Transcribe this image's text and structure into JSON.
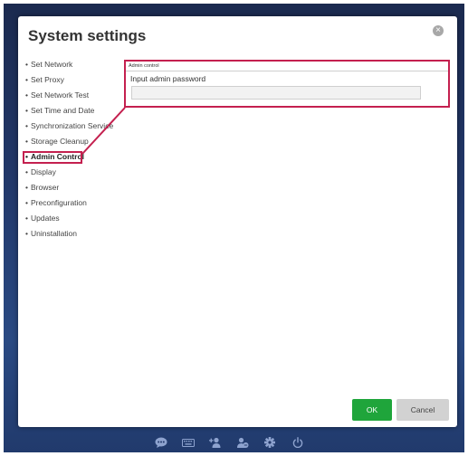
{
  "dialog": {
    "title": "System settings",
    "close_symbol": "×"
  },
  "nav": {
    "items": [
      {
        "label": "Set Network"
      },
      {
        "label": "Set Proxy"
      },
      {
        "label": "Set Network Test"
      },
      {
        "label": "Set Time and Date"
      },
      {
        "label": "Synchronization Service"
      },
      {
        "label": "Storage Cleanup"
      },
      {
        "label": "Admin Control",
        "active": true
      },
      {
        "label": "Display"
      },
      {
        "label": "Browser"
      },
      {
        "label": "Preconfiguration"
      },
      {
        "label": "Updates"
      },
      {
        "label": "Uninstallation"
      }
    ]
  },
  "panel": {
    "header": "Admin control",
    "label": "Input admin password",
    "password_value": "",
    "password_placeholder": ""
  },
  "buttons": {
    "ok_label": "OK",
    "cancel_label": "Cancel"
  },
  "taskbar": {
    "icons": [
      "chat-icon",
      "keyboard-icon",
      "add-user-icon",
      "switch-user-icon",
      "gear-icon",
      "power-icon"
    ]
  },
  "colors": {
    "highlight": "#c4204f",
    "ok_button": "#1fa53b",
    "cancel_button": "#d2d2d2",
    "background": "#22386a"
  }
}
